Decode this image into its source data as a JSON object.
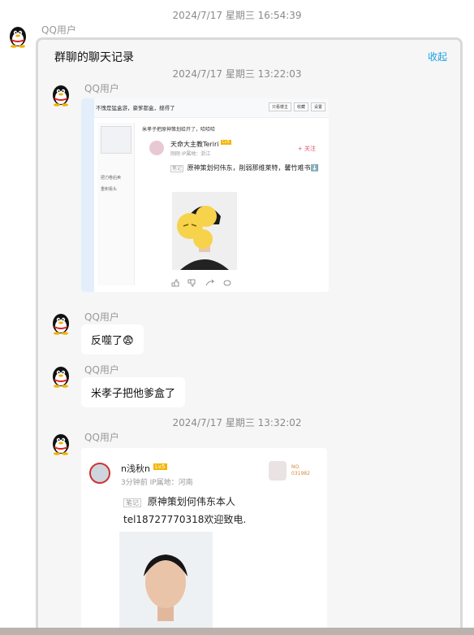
{
  "top_timestamp": "2024/7/17 星期三 16:54:39",
  "sender_name": "QQ用户",
  "forward_card": {
    "title": "群聊的聊天记录",
    "collapse_label": "收起",
    "messages": [
      {
        "timestamp": "2024/7/17 星期三 13:22:03",
        "name": "QQ用户",
        "type": "image",
        "image": {
          "header_text": "不愧是猛盒游，豪爹都盒，搜得了",
          "header_buttons": [
            "只看楼主",
            "收藏",
            "设置"
          ],
          "notice": "米孝子把原神策划给开了，哈哈哈",
          "sidebar_lines": [
            "把刀卷后卖",
            "重积看头"
          ],
          "poster": "天命大主教Teriri",
          "level": "Lv5",
          "meta": "刚刚  IP属地：浙江",
          "follow": "+ 关注",
          "note_tag": "笔记",
          "text": "原神策划何伟东，削弱那维莱特，馨竹难书⬇️"
        }
      },
      {
        "name": "QQ用户",
        "type": "text",
        "text": "反噬了😨"
      },
      {
        "name": "QQ用户",
        "type": "text",
        "text": "米孝子把他爹盒了"
      },
      {
        "timestamp": "2024/7/17 星期三 13:32:02",
        "name": "QQ用户",
        "type": "image",
        "image": {
          "poster": "n浅秋n",
          "level": "Lv5",
          "meta": "3分钟前  IP属地：河南",
          "badge_lines": [
            "NO.",
            "031982"
          ],
          "note_tag": "笔记",
          "text": "原神策划何伟东本人 tel18727770318欢迎致电."
        }
      }
    ]
  },
  "colors": {
    "accent_link": "#1aa0e6",
    "level_badge": "#f5b400",
    "follow_red": "#e0546b"
  }
}
